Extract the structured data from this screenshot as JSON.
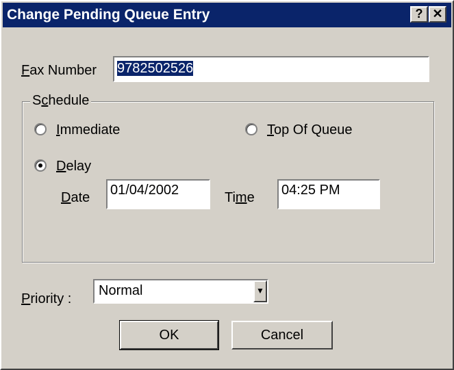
{
  "window": {
    "title": "Change Pending Queue Entry",
    "help_label": "?",
    "close_label": "✕"
  },
  "fax": {
    "label_key": "F",
    "label_rest": "ax Number",
    "value": "9782502526"
  },
  "schedule": {
    "legend_pre": "S",
    "legend_key": "c",
    "legend_rest": "hedule",
    "immediate_key": "I",
    "immediate_rest": "mmediate",
    "top_key": "T",
    "top_rest": "op Of Queue",
    "delay_key": "D",
    "delay_rest": "elay",
    "selected": "delay",
    "date_label_key": "D",
    "date_label_rest": "ate",
    "date_value": "01/04/2002",
    "time_label_pre": "Ti",
    "time_label_key": "m",
    "time_label_rest": "e",
    "time_value": "04:25 PM"
  },
  "priority": {
    "label_key": "P",
    "label_rest": "riority :",
    "value": "Normal"
  },
  "buttons": {
    "ok": "OK",
    "cancel": "Cancel"
  },
  "colors": {
    "titlebar": "#0a246a",
    "face": "#d4d0c8"
  }
}
